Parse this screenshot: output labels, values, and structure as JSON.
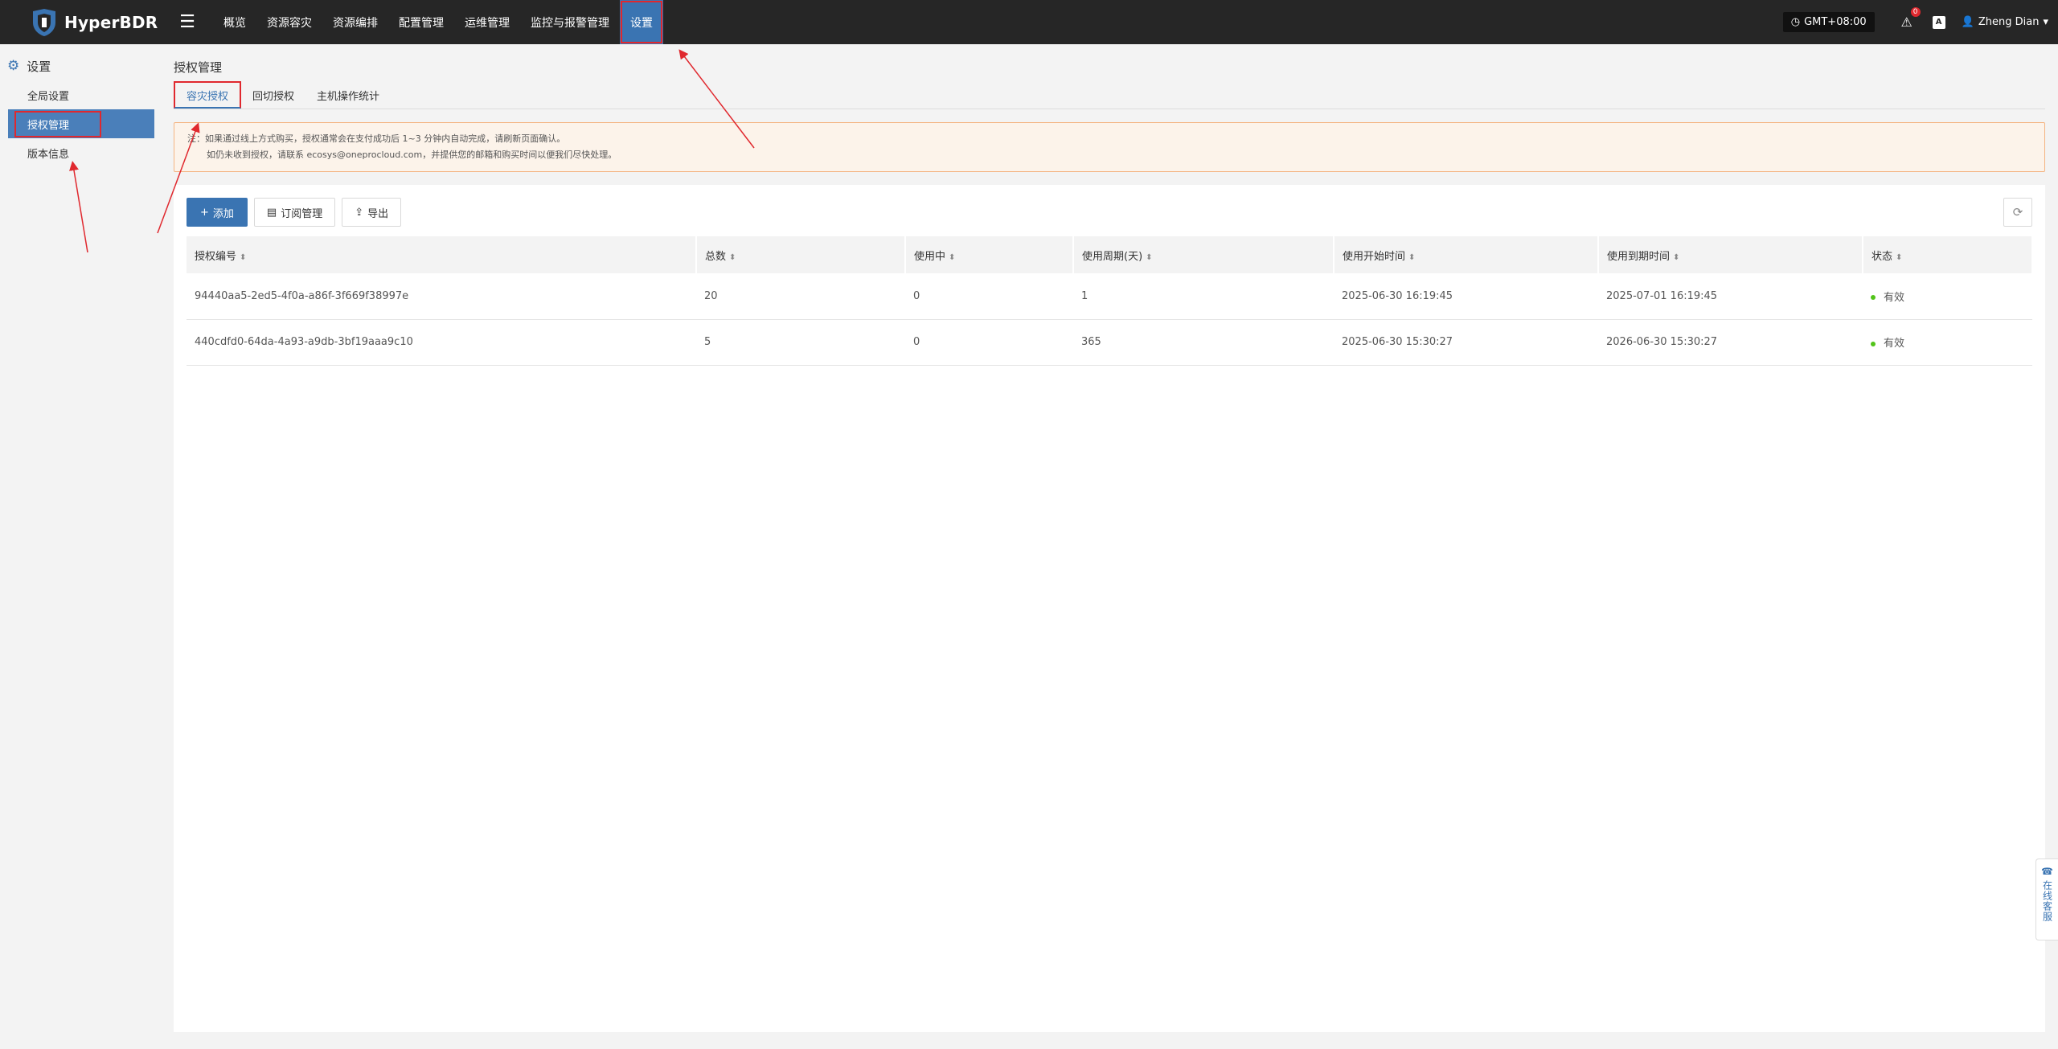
{
  "app": {
    "name": "HyperBDR"
  },
  "nav": {
    "items": [
      {
        "label": "概览"
      },
      {
        "label": "资源容灾"
      },
      {
        "label": "资源编排"
      },
      {
        "label": "配置管理"
      },
      {
        "label": "运维管理"
      },
      {
        "label": "监控与报警管理"
      },
      {
        "label": "设置"
      }
    ],
    "active_index": 6
  },
  "topright": {
    "timezone": "GMT+08:00",
    "alert_count": "0",
    "lang_icon_label": "A",
    "user": "Zheng Dian"
  },
  "sidebar": {
    "title": "设置",
    "items": [
      {
        "label": "全局设置"
      },
      {
        "label": "授权管理"
      },
      {
        "label": "版本信息"
      }
    ]
  },
  "page": {
    "title": "授权管理",
    "tabs": [
      {
        "label": "容灾授权"
      },
      {
        "label": "回切授权"
      },
      {
        "label": "主机操作统计"
      }
    ],
    "notice_line1": "注：如果通过线上方式购买，授权通常会在支付成功后 1~3 分钟内自动完成，请刷新页面确认。",
    "notice_line2": "如仍未收到授权，请联系 ecosys@oneprocloud.com，并提供您的邮箱和购买时间以便我们尽快处理。"
  },
  "toolbar": {
    "add_label": "添加",
    "subscribe_label": "订阅管理",
    "export_label": "导出"
  },
  "table": {
    "headers": [
      "授权编号",
      "总数",
      "使用中",
      "使用周期(天)",
      "使用开始时间",
      "使用到期时间",
      "状态"
    ],
    "rows": [
      [
        "94440aa5-2ed5-4f0a-a86f-3f669f38997e",
        "20",
        "0",
        "1",
        "2025-06-30 16:19:45",
        "2025-07-01 16:19:45",
        "有效"
      ],
      [
        "440cdfd0-64da-4a93-a9db-3bf19aaa9c10",
        "5",
        "0",
        "365",
        "2025-06-30 15:30:27",
        "2026-06-30 15:30:27",
        "有效"
      ]
    ]
  },
  "service": {
    "label": "在线客服"
  },
  "colors": {
    "primary": "#3a74b2",
    "topbar": "#262626",
    "highlight": "#e0282e",
    "status_ok": "#52c41a"
  }
}
